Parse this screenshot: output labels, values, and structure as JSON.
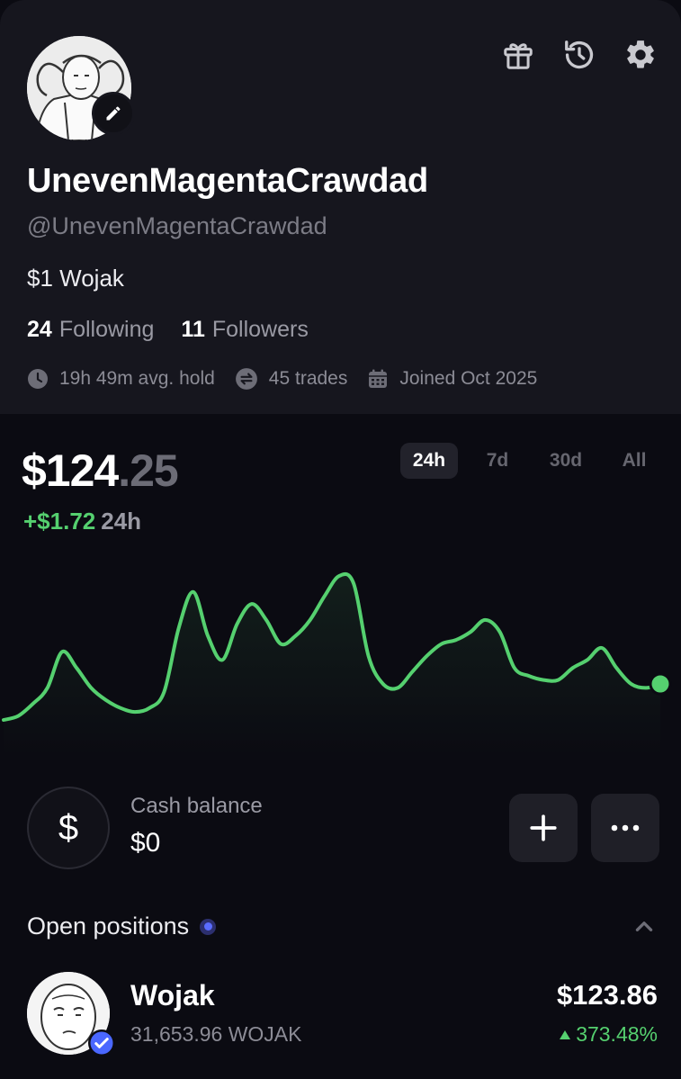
{
  "profile": {
    "display_name": "UnevenMagentaCrawdad",
    "handle": "@UnevenMagentaCrawdad",
    "bio": "$1 Wojak",
    "following_count": "24",
    "following_label": "Following",
    "followers_count": "11",
    "followers_label": "Followers",
    "stats": {
      "avg_hold": "19h 49m avg. hold",
      "trades": "45 trades",
      "joined": "Joined Oct 2025"
    }
  },
  "header_icons": [
    "gift-icon",
    "history-icon",
    "gear-icon"
  ],
  "portfolio": {
    "balance_whole": "$124",
    "balance_cents": ".25",
    "change_value": "+$1.72",
    "change_period": "24h",
    "ranges": [
      "24h",
      "7d",
      "30d",
      "All"
    ],
    "selected_range": "24h"
  },
  "chart_data": {
    "type": "line",
    "title": "",
    "xlabel": "",
    "ylabel": "",
    "grid": false,
    "legend": "none",
    "color": "#55d06f",
    "values": [
      9.5,
      9.6,
      9.9,
      10.3,
      11.2,
      10.8,
      10.3,
      10.0,
      9.8,
      9.7,
      9.8,
      10.2,
      11.8,
      12.7,
      11.6,
      11.0,
      11.9,
      12.4,
      12.0,
      11.4,
      11.6,
      12.0,
      12.6,
      13.1,
      12.9,
      11.1,
      10.4,
      10.3,
      10.7,
      11.1,
      11.4,
      11.5,
      11.7,
      12.0,
      11.7,
      10.8,
      10.6,
      10.5,
      10.5,
      10.8,
      11.0,
      11.3,
      10.8,
      10.4,
      10.3,
      10.4
    ]
  },
  "cash": {
    "label": "Cash balance",
    "value": "$0",
    "symbol": "$"
  },
  "positions": {
    "title": "Open positions",
    "items": [
      {
        "name": "Wojak",
        "amount": "31,653.96 WOJAK",
        "value": "$123.86",
        "change": "373.48%"
      }
    ]
  }
}
